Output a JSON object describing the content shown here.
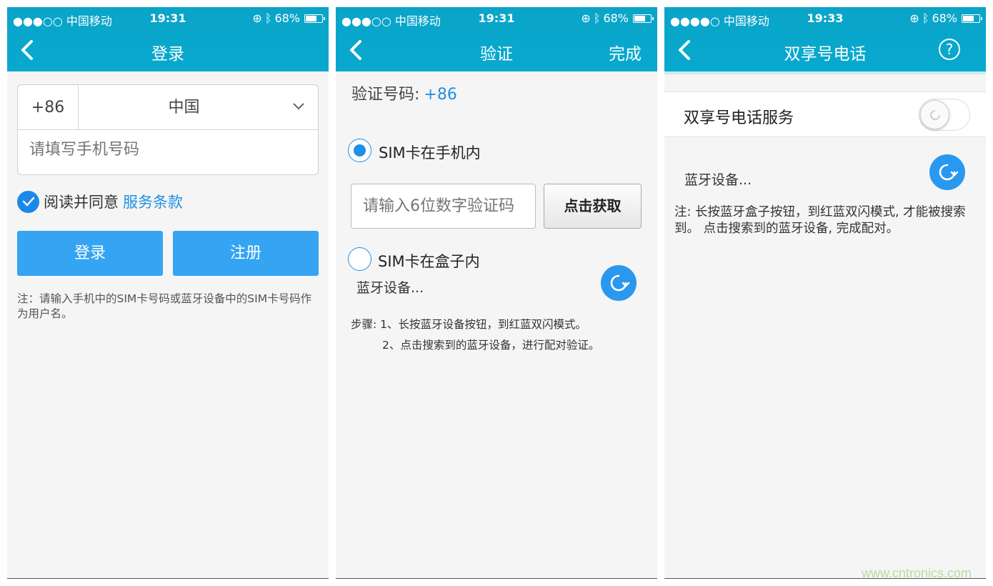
{
  "status": {
    "carrier": "●●●○○ 中国移动",
    "carrier_3": "●●●●○ 中国移动",
    "time_1": "19:31",
    "time_2": "19:31",
    "time_3": "19:33",
    "battery": "68%"
  },
  "screen1": {
    "title": "登录",
    "country_code": "+86",
    "country": "中国",
    "phone_placeholder": "请填写手机号码",
    "agree_text": "阅读并同意",
    "terms_link": "服务条款",
    "login_label": "登录",
    "register_label": "注册",
    "note": "注：请输入手机中的SIM卡号码或蓝牙设备中的SIM卡号码作为用户名。"
  },
  "screen2": {
    "title": "验证",
    "done_label": "完成",
    "verify_label": "验证号码:",
    "verify_code": "+86",
    "option_phone": "SIM卡在手机内",
    "code_placeholder": "请输入6位数字验证码",
    "get_code_label": "点击获取",
    "option_box": "SIM卡在盒子内",
    "bt_devices": "蓝牙设备...",
    "step1": "步骤: 1、长按蓝牙设备按钮，到红蓝双闪模式。",
    "step2": "2、点击搜索到的蓝牙设备，进行配对验证。"
  },
  "screen3": {
    "title": "双享号电话",
    "service_label": "双享号电话服务",
    "bt_devices": "蓝牙设备...",
    "note": "注: 长按蓝牙盒子按钮，到红蓝双闪模式, 才能被搜索到。 点击搜索到的蓝牙设备, 完成配对。"
  },
  "watermark": "www.cntronics.com",
  "colors": {
    "header": "#08a9cf",
    "accent": "#1e90e6",
    "button": "#35a4f2"
  }
}
